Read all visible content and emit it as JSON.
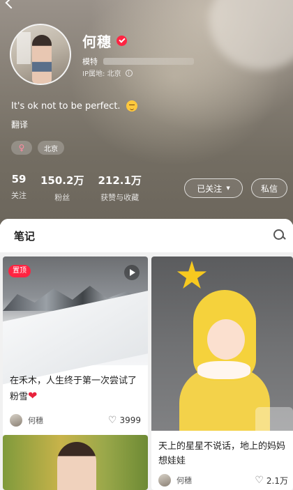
{
  "profile": {
    "name": "何穗",
    "profession_label": "模特",
    "ip_location": "IP属地: 北京",
    "bio": "It's ok not to be perfect.",
    "translate_label": "翻译",
    "tags": {
      "city": "北京"
    },
    "stats": [
      {
        "value": "59",
        "label": "关注"
      },
      {
        "value": "150.2万",
        "label": "粉丝"
      },
      {
        "value": "212.1万",
        "label": "获赞与收藏"
      }
    ],
    "follow_button": "已关注",
    "message_button": "私信"
  },
  "tabs": {
    "notes": "笔记"
  },
  "notes": [
    {
      "pinned_label": "置顶",
      "title": "在禾木，人生终于第一次尝试了粉雪",
      "author": "何穗",
      "likes": "3999"
    },
    {
      "title": "天上的星星不说话，地上的妈妈想娃娃",
      "author": "何穗",
      "likes": "2.1万"
    }
  ],
  "colors": {
    "accent": "#ff2442",
    "header_bg": "#7a7368"
  },
  "icons": {
    "verify": "verified-check-icon",
    "female": "female-icon",
    "search": "search-icon",
    "play": "play-icon",
    "like": "heart-outline-icon"
  }
}
